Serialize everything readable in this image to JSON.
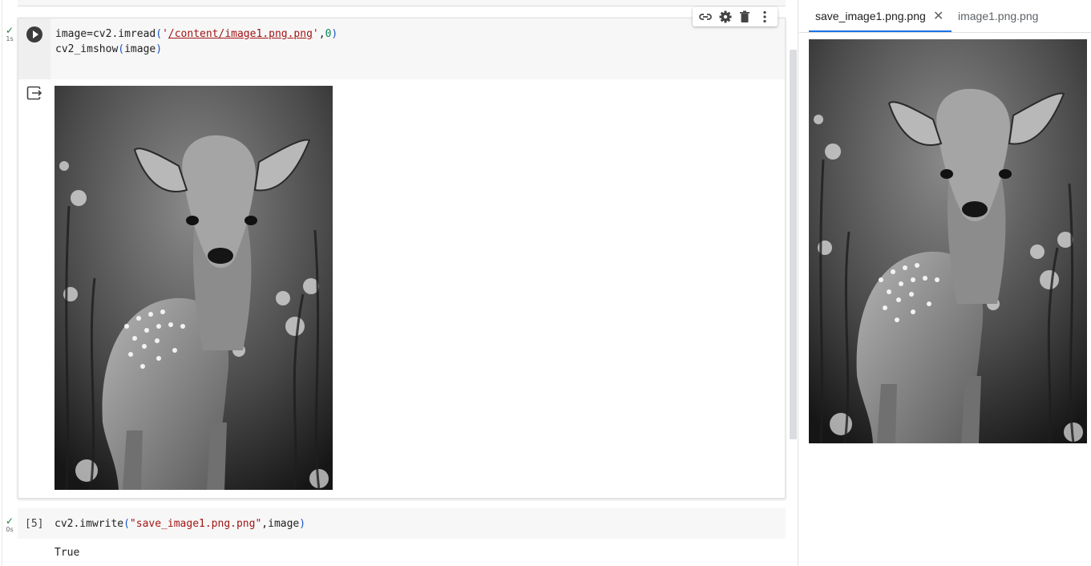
{
  "cell1": {
    "status_time": "1s",
    "code_line1_pre": "image=cv2.imread",
    "code_line1_open": "(",
    "code_line1_q1": "'",
    "code_line1_path": "/content/image1.png.png",
    "code_line1_q2": "'",
    "code_line1_comma": ",",
    "code_line1_num": "0",
    "code_line1_close": ")",
    "code_line2_pre": "cv2_imshow",
    "code_line2_open": "(",
    "code_line2_arg": "image",
    "code_line2_close": ")",
    "output_image_icon": "deer-photo-grayscale"
  },
  "cell2": {
    "status_time": "0s",
    "prompt": "[5]",
    "code_pre": "cv2.imwrite",
    "code_open": "(",
    "code_str": "\"save_image1.png.png\"",
    "code_rest": ",image",
    "code_close": ")",
    "output": "True"
  },
  "toolbar": {
    "icons": [
      "link-icon",
      "gear-icon",
      "trash-icon",
      "more-vert-icon"
    ]
  },
  "side_panel": {
    "tabs": [
      {
        "label": "save_image1.png.png",
        "active": true,
        "closable": true
      },
      {
        "label": "image1.png.png",
        "active": false
      }
    ],
    "image_icon": "deer-photo-grayscale"
  },
  "colors": {
    "accent": "#1a73e8",
    "string": "#a31515",
    "number": "#098658",
    "success": "#188038"
  }
}
